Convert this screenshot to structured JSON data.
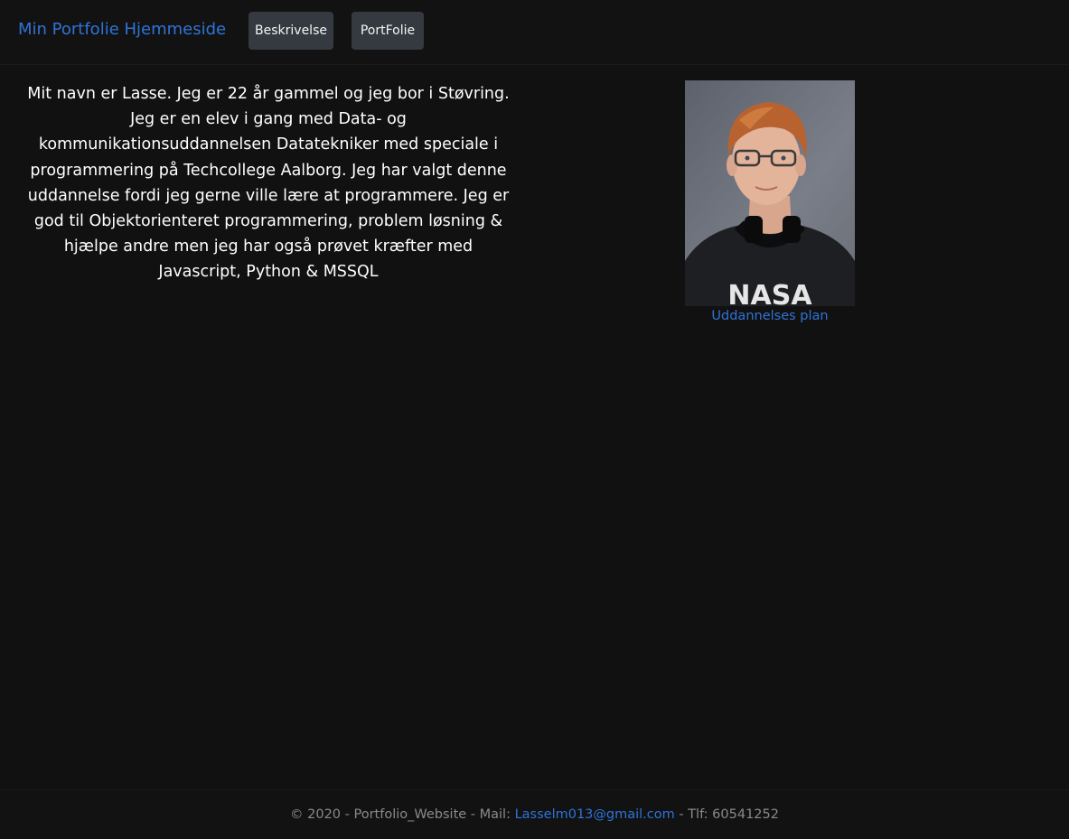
{
  "navbar": {
    "brand": "Min Portfolie Hjemmeside",
    "buttons": [
      {
        "label": "Beskrivelse"
      },
      {
        "label": "PortFolie"
      }
    ]
  },
  "main": {
    "bio": "Mit navn er Lasse. Jeg er 22 år gammel og jeg bor i Støvring. Jeg er en elev i gang med Data- og kommunikationsuddannelsen Datatekniker med speciale i programmering på Techcollege Aalborg. Jeg har valgt denne uddannelse fordi jeg gerne ville lære at programmere. Jeg er god til Objektorienteret programmering, problem løsning & hjælpe andre men jeg har også prøvet kræfter med Javascript, Python & MSSQL",
    "photo_logo_text": "NASA",
    "education_link": "Uddannelses plan"
  },
  "footer": {
    "prefix": "© 2020 - Portfolio_Website - Mail: ",
    "email": "Lasselm013@gmail.com",
    "suffix": " - Tlf: 60541252"
  },
  "colors": {
    "background": "#111111",
    "link_blue": "#2f74d8",
    "button_bg": "#343a40"
  }
}
